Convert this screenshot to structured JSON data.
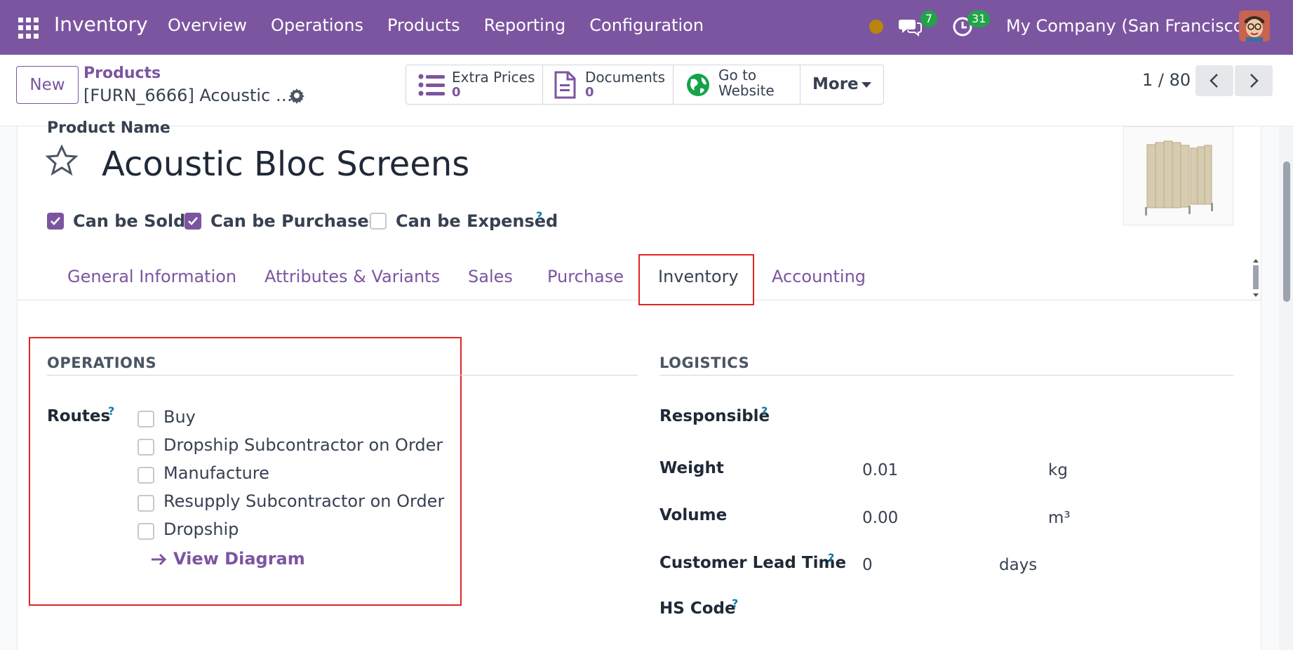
{
  "navbar": {
    "app_name": "Inventory",
    "menu": [
      "Overview",
      "Operations",
      "Products",
      "Reporting",
      "Configuration"
    ],
    "messages_count": "7",
    "activities_count": "31",
    "company": "My Company (San Francisco)",
    "brand_color": "#7c55a0"
  },
  "control": {
    "new_label": "New",
    "breadcrumb_parent": "Products",
    "breadcrumb_current": "[FURN_6666] Acoustic …",
    "smart_buttons": [
      {
        "label": "Extra Prices",
        "count": "0",
        "icon": "list-icon"
      },
      {
        "label": "Documents",
        "count": "0",
        "icon": "document-icon"
      },
      {
        "label": "Go to",
        "label2": "Website",
        "icon": "globe-icon"
      }
    ],
    "more_label": "More",
    "pager": "1 / 80"
  },
  "form": {
    "product_name_label": "Product Name",
    "product_name": "Acoustic Bloc Screens",
    "options": [
      {
        "label": "Can be Sold",
        "checked": true
      },
      {
        "label": "Can be Purchased",
        "checked": true
      },
      {
        "label": "Can be Expensed",
        "checked": false
      }
    ],
    "tabs": [
      "General Information",
      "Attributes & Variants",
      "Sales",
      "Purchase",
      "Inventory",
      "Accounting"
    ],
    "active_tab": "Inventory",
    "operations": {
      "title": "OPERATIONS",
      "routes_label": "Routes",
      "routes": [
        "Buy",
        "Dropship Subcontractor on Order",
        "Manufacture",
        "Resupply Subcontractor on Order",
        "Dropship"
      ],
      "view_diagram": "View Diagram"
    },
    "logistics": {
      "title": "LOGISTICS",
      "responsible_label": "Responsible",
      "weight_label": "Weight",
      "weight_value": "0.01",
      "weight_unit": "kg",
      "volume_label": "Volume",
      "volume_value": "0.00",
      "volume_unit": "m³",
      "lead_time_label": "Customer Lead Time",
      "lead_time_value": "0",
      "lead_time_unit": "days",
      "hs_code_label": "HS Code",
      "help_mark": "?"
    }
  }
}
